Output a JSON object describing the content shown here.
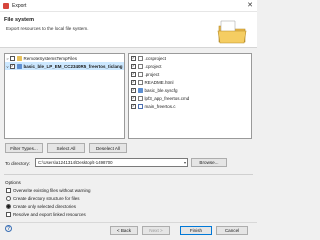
{
  "window": {
    "title": "Export"
  },
  "header": {
    "title": "File system",
    "description": "Export resources to the local file system."
  },
  "tree": {
    "items": [
      {
        "label": "RemoteSystemsTempFiles",
        "checked": false,
        "expand": ">"
      },
      {
        "label": "basic_ble_LP_EM_CC2340R5_freertos_ticlang",
        "checked": true,
        "expand": "v"
      }
    ]
  },
  "files": [
    {
      "label": ".ccsproject",
      "checked": true
    },
    {
      "label": ".cproject",
      "checked": true
    },
    {
      "label": ".project",
      "checked": true
    },
    {
      "label": "README.html",
      "checked": true
    },
    {
      "label": "basic_ble.syscfg",
      "checked": true
    },
    {
      "label": "lpf3_app_freertos.cmd",
      "checked": true
    },
    {
      "label": "main_freertos.c",
      "checked": true
    }
  ],
  "selection_buttons": {
    "filter_types": "Filter Types...",
    "select_all": "Select All",
    "deselect_all": "Deselect All"
  },
  "destination": {
    "label": "To directory:",
    "value": "C:\\Users\\a1241314\\Desktop\\t-1498700",
    "browse": "Browse..."
  },
  "options": {
    "label": "Options",
    "overwrite": {
      "label": "Overwrite existing files without warning",
      "checked": false
    },
    "create_structure": {
      "label": "Create directory structure for files",
      "selected": false
    },
    "create_selected": {
      "label": "Create only selected directories",
      "selected": true
    },
    "resolve_linked": {
      "label": "Resolve and export linked resources",
      "checked": false
    }
  },
  "footer": {
    "help": "?",
    "back": "< Back",
    "next": "Next >",
    "finish": "Finish",
    "cancel": "Cancel"
  },
  "icons": {
    "close": "close-icon",
    "help": "help-icon",
    "folder": "folder-icon",
    "banner": "folder-export-banner-icon"
  },
  "colors": {
    "accent": "#0078d7",
    "selection": "#cce8ff"
  }
}
